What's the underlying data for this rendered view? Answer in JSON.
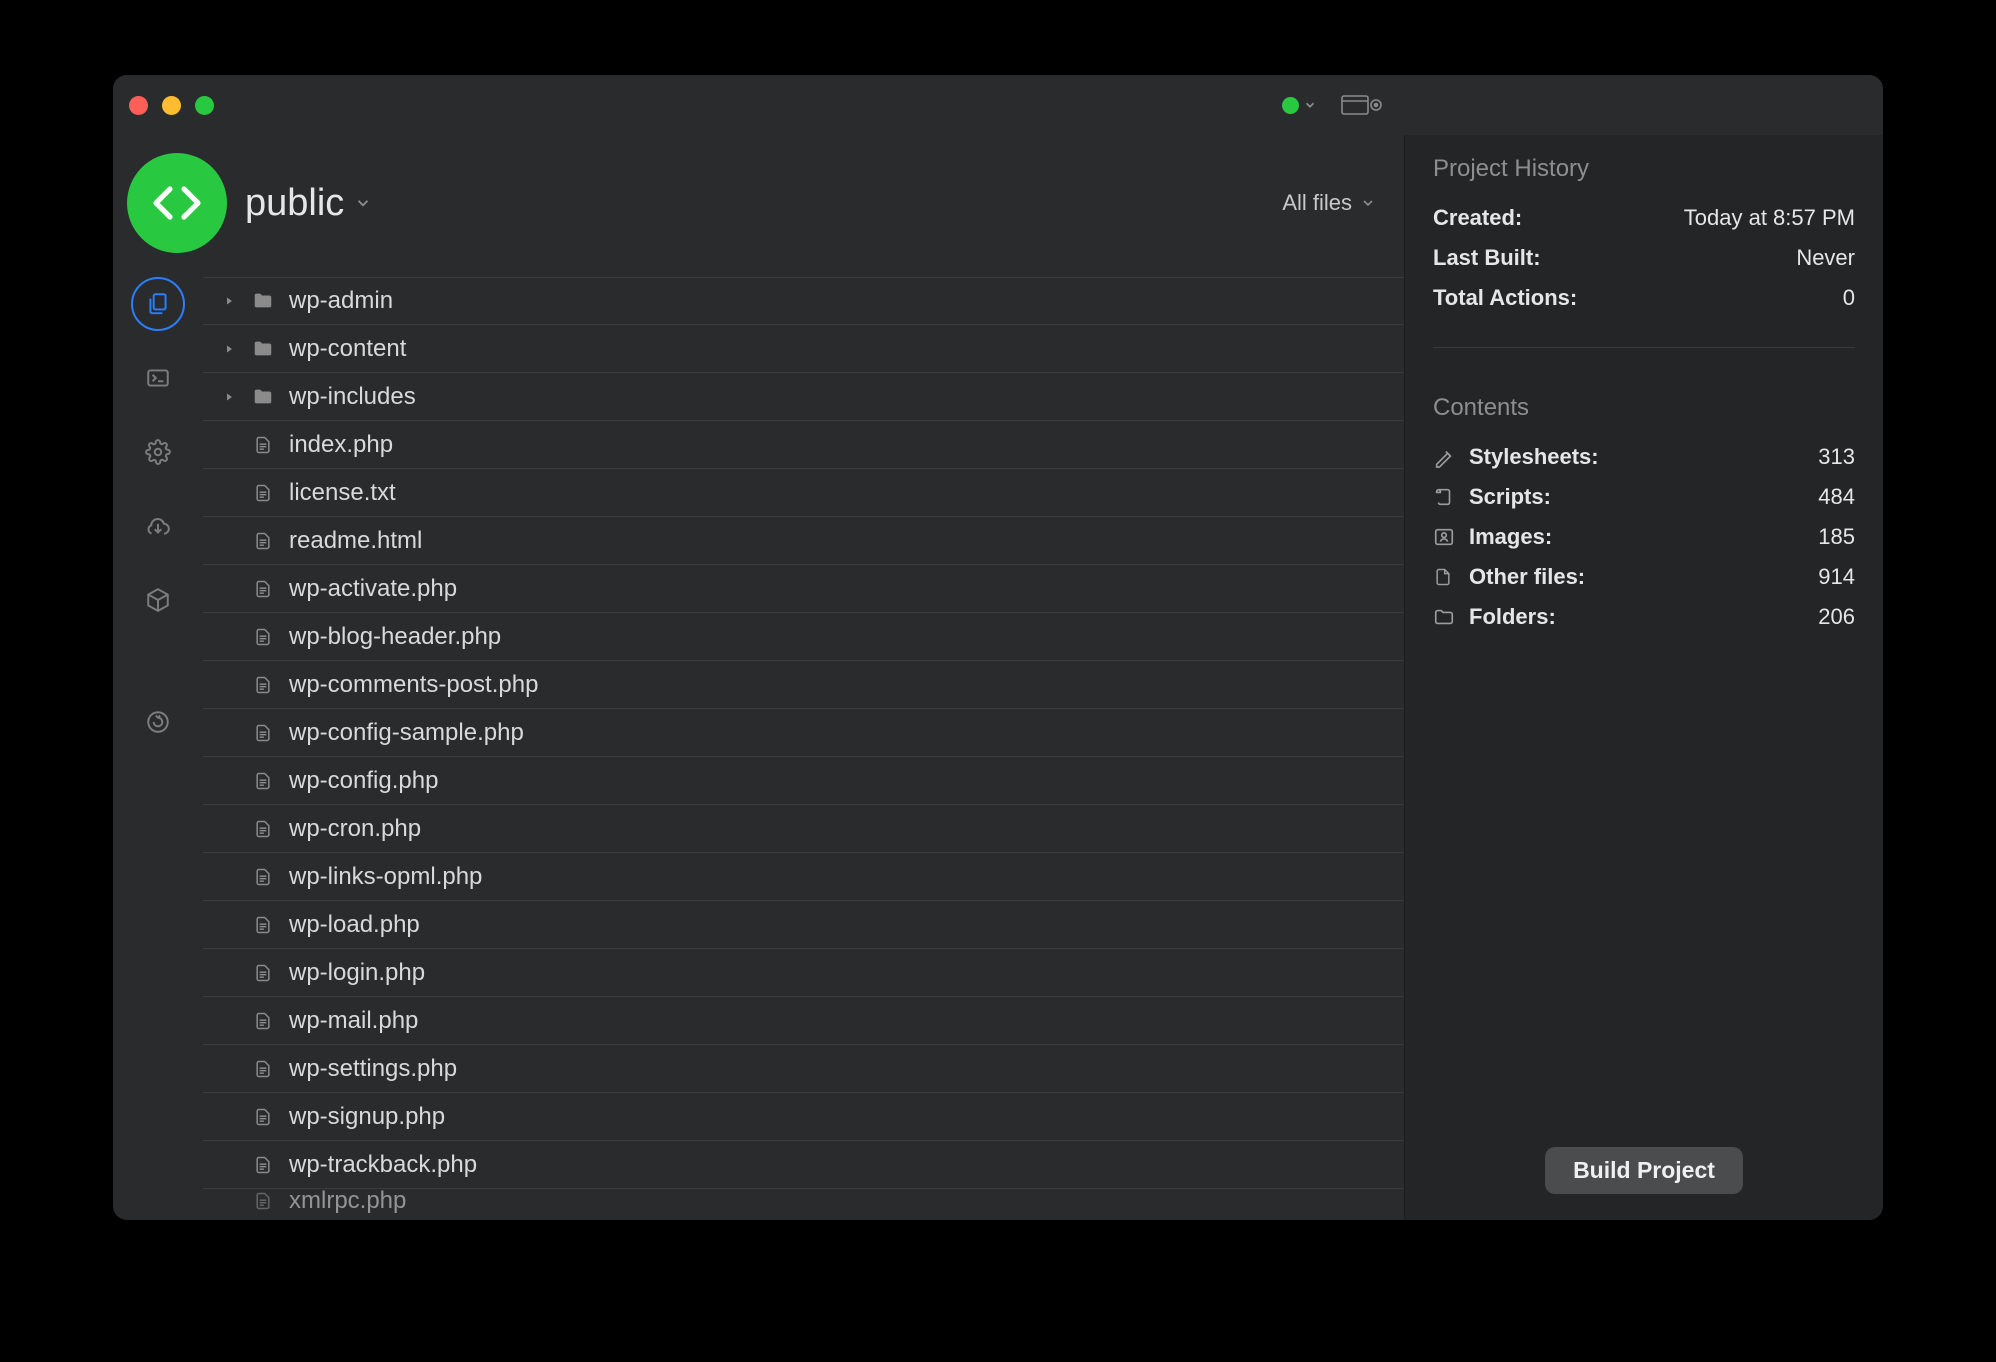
{
  "project": {
    "name": "public"
  },
  "header": {
    "filter_label": "All files"
  },
  "sidebar": {
    "items": [
      {
        "name": "files",
        "active": true
      },
      {
        "name": "terminal",
        "active": false
      },
      {
        "name": "settings",
        "active": false
      },
      {
        "name": "cloud",
        "active": false
      },
      {
        "name": "packages",
        "active": false
      },
      {
        "name": "refresh",
        "active": false
      }
    ]
  },
  "files": [
    {
      "name": "wp-admin",
      "type": "folder",
      "expandable": true
    },
    {
      "name": "wp-content",
      "type": "folder",
      "expandable": true
    },
    {
      "name": "wp-includes",
      "type": "folder",
      "expandable": true
    },
    {
      "name": "index.php",
      "type": "file",
      "expandable": false
    },
    {
      "name": "license.txt",
      "type": "file",
      "expandable": false
    },
    {
      "name": "readme.html",
      "type": "file",
      "expandable": false
    },
    {
      "name": "wp-activate.php",
      "type": "file",
      "expandable": false
    },
    {
      "name": "wp-blog-header.php",
      "type": "file",
      "expandable": false
    },
    {
      "name": "wp-comments-post.php",
      "type": "file",
      "expandable": false
    },
    {
      "name": "wp-config-sample.php",
      "type": "file",
      "expandable": false
    },
    {
      "name": "wp-config.php",
      "type": "file",
      "expandable": false
    },
    {
      "name": "wp-cron.php",
      "type": "file",
      "expandable": false
    },
    {
      "name": "wp-links-opml.php",
      "type": "file",
      "expandable": false
    },
    {
      "name": "wp-load.php",
      "type": "file",
      "expandable": false
    },
    {
      "name": "wp-login.php",
      "type": "file",
      "expandable": false
    },
    {
      "name": "wp-mail.php",
      "type": "file",
      "expandable": false
    },
    {
      "name": "wp-settings.php",
      "type": "file",
      "expandable": false
    },
    {
      "name": "wp-signup.php",
      "type": "file",
      "expandable": false
    },
    {
      "name": "wp-trackback.php",
      "type": "file",
      "expandable": false
    }
  ],
  "partial_file": {
    "name": "xmlrpc.php"
  },
  "panel": {
    "history_heading": "Project History",
    "history": {
      "created_label": "Created:",
      "created_value": "Today at 8:57 PM",
      "last_built_label": "Last Built:",
      "last_built_value": "Never",
      "total_actions_label": "Total Actions:",
      "total_actions_value": "0"
    },
    "contents_heading": "Contents",
    "contents": [
      {
        "icon": "stylesheet",
        "label": "Stylesheets:",
        "value": "313"
      },
      {
        "icon": "script",
        "label": "Scripts:",
        "value": "484"
      },
      {
        "icon": "image",
        "label": "Images:",
        "value": "185"
      },
      {
        "icon": "file",
        "label": "Other files:",
        "value": "914"
      },
      {
        "icon": "folder",
        "label": "Folders:",
        "value": "206"
      }
    ],
    "build_button": "Build Project"
  },
  "colors": {
    "accent_green": "#28c840",
    "accent_blue": "#2a7fff",
    "bg_main": "#2a2b2d",
    "bg_panel": "#242527"
  }
}
